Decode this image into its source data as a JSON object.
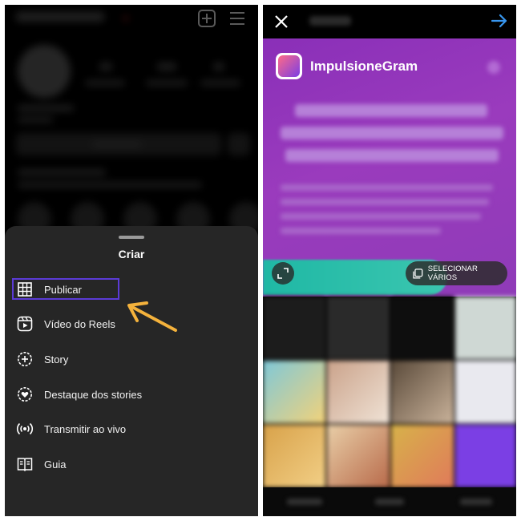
{
  "create_sheet": {
    "title": "Criar",
    "items": [
      {
        "label": "Publicar",
        "icon": "grid-icon"
      },
      {
        "label": "Vídeo do Reels",
        "icon": "reels-icon"
      },
      {
        "label": "Story",
        "icon": "story-plus-icon"
      },
      {
        "label": "Destaque dos stories",
        "icon": "highlight-heart-icon"
      },
      {
        "label": "Transmitir ao vivo",
        "icon": "live-broadcast-icon"
      },
      {
        "label": "Guia",
        "icon": "guide-book-icon"
      }
    ]
  },
  "new_post": {
    "brand_name": "ImpulsioneGram",
    "select_multiple_label": "SELECIONAR VÁRIOS"
  },
  "colors": {
    "highlight_border": "#5b3bd6",
    "arrow": "#f4b23c",
    "next_arrow": "#3897f0",
    "preview_purple": "#8f3bb8",
    "cta_teal": "#2fbfaa"
  }
}
